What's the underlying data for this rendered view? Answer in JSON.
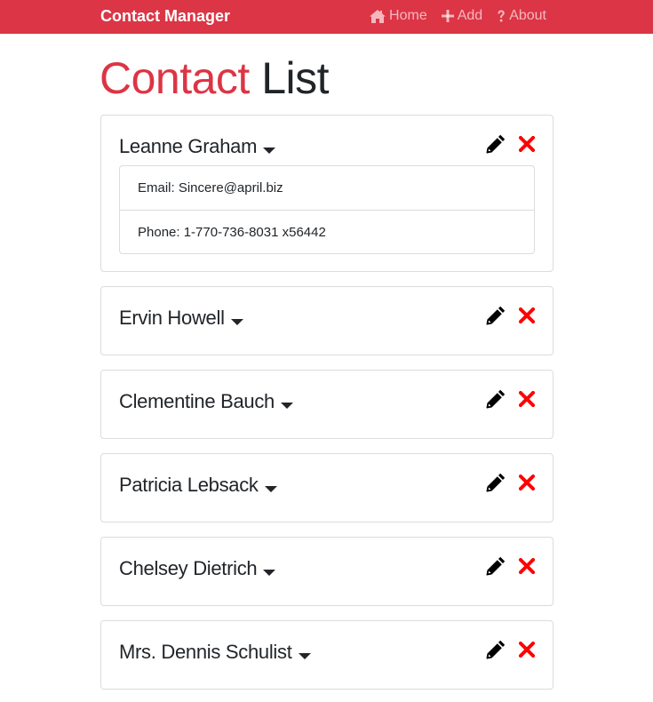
{
  "navbar": {
    "brand": "Contact Manager",
    "links": [
      {
        "label": "Home",
        "icon": "home-icon"
      },
      {
        "label": "Add",
        "icon": "plus-icon"
      },
      {
        "label": "About",
        "icon": "question-icon"
      }
    ]
  },
  "page": {
    "title_accent": "Contact",
    "title_rest": "List"
  },
  "contacts": [
    {
      "name": "Leanne Graham",
      "expanded": true,
      "email_label": "Email: Sincere@april.biz",
      "phone_label": "Phone: 1-770-736-8031 x56442"
    },
    {
      "name": "Ervin Howell",
      "expanded": false
    },
    {
      "name": "Clementine Bauch",
      "expanded": false
    },
    {
      "name": "Patricia Lebsack",
      "expanded": false
    },
    {
      "name": "Chelsey Dietrich",
      "expanded": false
    },
    {
      "name": "Mrs. Dennis Schulist",
      "expanded": false
    }
  ],
  "colors": {
    "brand": "#dc3545",
    "delete": "#ff0000",
    "text": "#212529"
  }
}
